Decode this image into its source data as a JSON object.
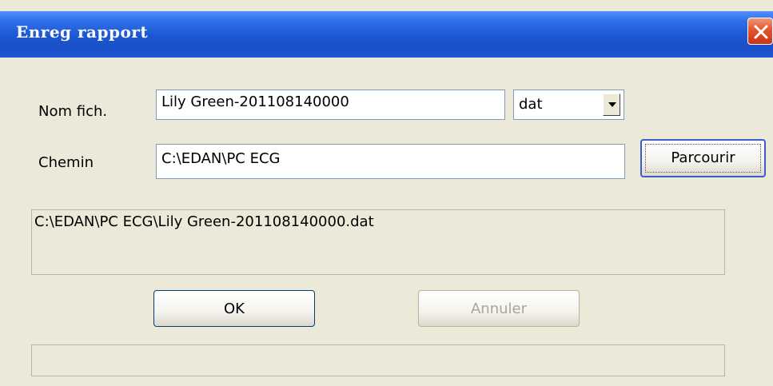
{
  "window": {
    "title": "Enreg rapport",
    "close_icon": "close-icon"
  },
  "form": {
    "filename_label": "Nom fich.",
    "filename_value": "Lily Green-201108140000",
    "extension_value": "dat",
    "path_label": "Chemin",
    "path_value": "C:\\EDAN\\PC ECG",
    "browse_label": "Parcourir",
    "full_path": "C:\\EDAN\\PC ECG\\Lily Green-201108140000.dat",
    "status_text": ""
  },
  "actions": {
    "ok_label": "OK",
    "cancel_label": "Annuler"
  },
  "colors": {
    "titlebar": "#1b56d4",
    "close_button": "#e2542d",
    "window_background": "#ece9d8",
    "disabled_text": "#a7a699"
  }
}
